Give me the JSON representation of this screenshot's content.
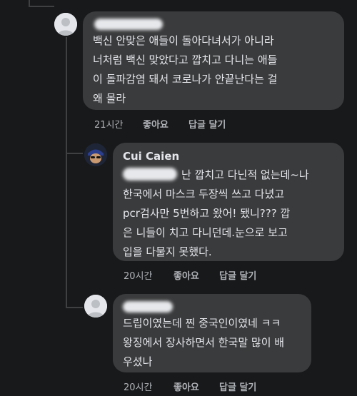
{
  "comments": [
    {
      "author": "",
      "text": "백신 안맞은 애들이 돌아다녀서가 아니라\n너처럼 백신 맞았다고 깝치고 다니는 애들\n이 돌파감염 돼서 코로나가 안끝난다는 걸\n왜 몰라",
      "time": "21시간",
      "like_label": "좋아요",
      "reply_label": "답글 달기"
    },
    {
      "author": "Cui Caien",
      "text_first": "난 깝치고 다닌적 없는데~나",
      "text_rest": "한국에서 마스크 두장씩 쓰고 다녔고\npcr검사만 5번하고 왔어! 됐니??? 깝\n은 니들이 치고 다니던데.눈으로 보고\n입을 다물지 못했다.",
      "time": "20시간",
      "like_label": "좋아요",
      "reply_label": "답글 달기"
    },
    {
      "author": "",
      "text": "드립이였는데 찐 중국인이였네 ㅋㅋ\n왕징에서 장사하면서 한국말 많이 배\n우셨나",
      "time": "20시간",
      "like_label": "좋아요",
      "reply_label": "답글 달기"
    }
  ]
}
